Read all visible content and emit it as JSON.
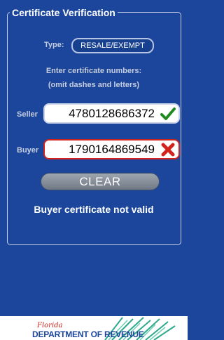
{
  "panel": {
    "legend": "Certificate Verification"
  },
  "type": {
    "label": "Type:",
    "button_label": "RESALE/EXEMPT"
  },
  "instructions": {
    "line1": "Enter certificate numbers:",
    "line2": "(omit dashes and letters)"
  },
  "seller": {
    "label": "Seller",
    "value": "4780128686372",
    "status_icon": "check-icon",
    "status_color": "#1e8a1e"
  },
  "buyer": {
    "label": "Buyer",
    "value": "1790164869549",
    "status_icon": "x-icon",
    "status_color": "#d2231f"
  },
  "clear_button": {
    "label": "CLEAR"
  },
  "status_message": "Buyer certificate not valid",
  "footer": {
    "script_text": "Florida",
    "department_text": "DEPARTMENT OF REVENUE"
  }
}
